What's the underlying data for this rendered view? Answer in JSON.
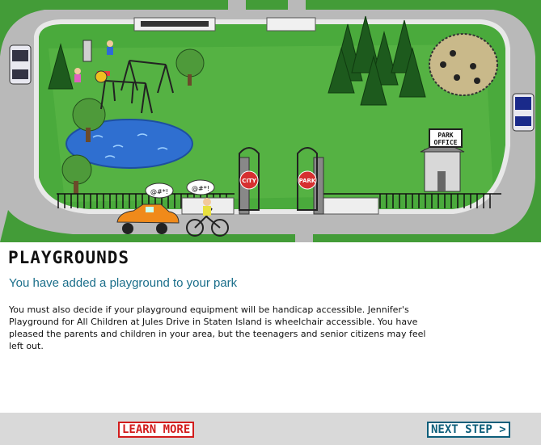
{
  "scene": {
    "signs": {
      "city": "CITY",
      "park": "PARK",
      "office_line1": "PARK",
      "office_line2": "OFFICE"
    },
    "speech": {
      "driver": "@#*!",
      "cyclist": "@#*!"
    }
  },
  "content": {
    "title": "PLAYGROUNDS",
    "subtitle": "You have added a playground to your park",
    "body": "You must also decide if your playground equipment will be handicap accessible. Jennifer's Playground for All Children at Jules Drive in Staten Island is wheelchair accessible. You have pleased the parents and children in your area, but the teenagers and senior citizens may feel left out."
  },
  "footer": {
    "learn_more": "LEARN MORE",
    "next_step": "NEXT STEP >"
  }
}
